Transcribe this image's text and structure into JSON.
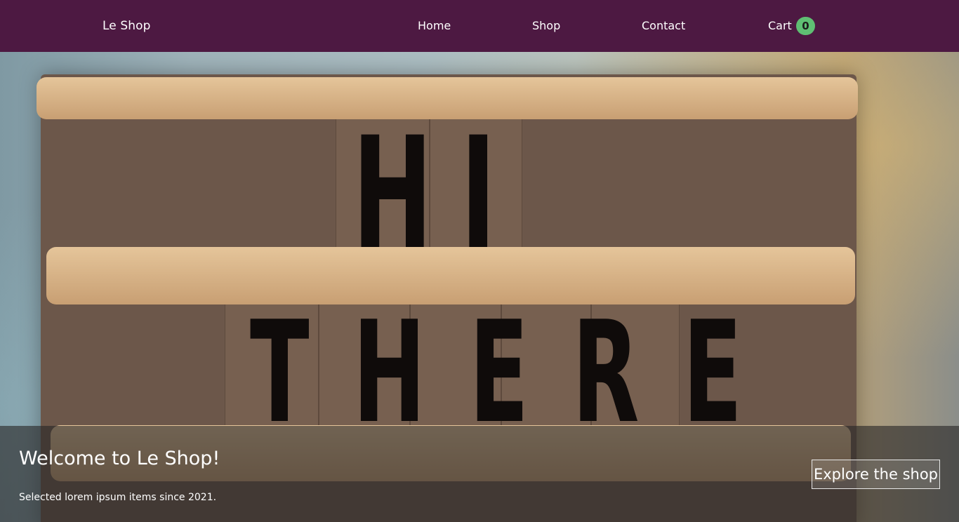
{
  "navbar": {
    "brand": "Le Shop",
    "links": [
      {
        "label": "Home"
      },
      {
        "label": "Shop"
      },
      {
        "label": "Contact"
      }
    ],
    "cart": {
      "label": "Cart",
      "count": "0"
    },
    "background_color": "#4d1942",
    "badge_color": "#5fbf73"
  },
  "hero": {
    "image_letters": {
      "line1": "HI",
      "line2": "THERE"
    }
  },
  "banner": {
    "title": "Welcome to Le Shop!",
    "subtitle": "Selected lorem ipsum items since 2021.",
    "button_label": "Explore the shop"
  }
}
